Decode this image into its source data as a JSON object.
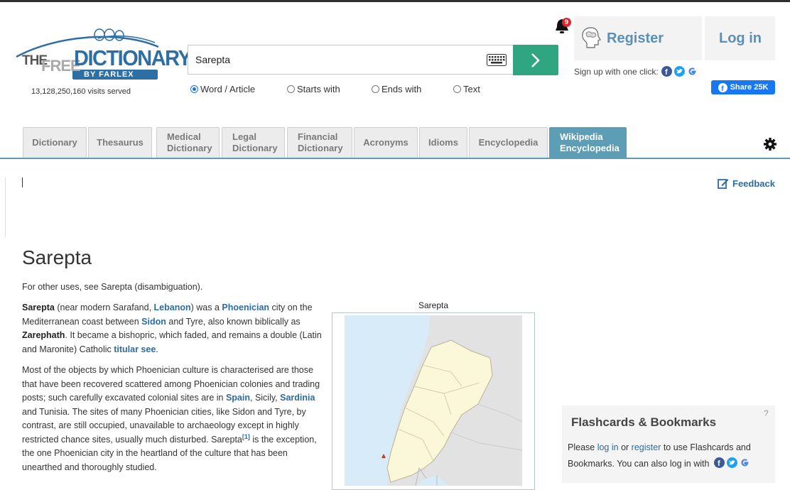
{
  "logo": {
    "the": "THE",
    "free": "FREE",
    "dictionary": "DICTIONARY",
    "byline": "BY FARLEX"
  },
  "visits": "13,128,250,160 visits served",
  "search": {
    "value": "Sarepta",
    "keyboard_icon": "keyboard-icon",
    "go_icon": "chevron-right-icon"
  },
  "search_modes": [
    {
      "label": "Word / Article",
      "selected": true
    },
    {
      "label": "Starts with",
      "selected": false
    },
    {
      "label": "Ends with",
      "selected": false
    },
    {
      "label": "Text",
      "selected": false
    }
  ],
  "notifications": {
    "count": "9"
  },
  "account": {
    "register": "Register",
    "login": "Log in",
    "signup_text": "Sign up with one click:"
  },
  "share": {
    "label": "Share 25K"
  },
  "tabs": [
    {
      "label": "Dictionary"
    },
    {
      "label": "Thesaurus"
    },
    {
      "label": "Medical Dictionary"
    },
    {
      "label": "Legal Dictionary"
    },
    {
      "label": "Financial Dictionary"
    },
    {
      "label": "Acronyms"
    },
    {
      "label": "Idioms"
    },
    {
      "label": "Encyclopedia"
    },
    {
      "label": "Wikipedia Encyclopedia",
      "active": true
    }
  ],
  "feedback": "Feedback",
  "article": {
    "title": "Sarepta",
    "disambig": "For other uses, see Sarepta (disambiguation).",
    "p1": {
      "t1": "Sarepta",
      "t2": " (near modern Sarafand, ",
      "l1": "Lebanon",
      "t3": ") was a ",
      "l2": "Phoenician",
      "t4": " city on the Mediterranean coast between ",
      "l3": "Sidon",
      "t5": " and Tyre, also known biblically as ",
      "t6": "Zarephath",
      "t7": ". It became a bishopric, which faded, and remains a double (Latin and Maronite) Catholic ",
      "l4": "titular see",
      "t8": "."
    },
    "p2": {
      "t1": "Most of the objects by which Phoenician culture is characterised are those that have been recovered scattered among Phoenician colonies and trading posts; such carefully excavated colonial sites are in ",
      "l1": "Spain",
      "t2": ", Sicily, ",
      "l2": "Sardinia",
      "t3": " and Tunisia. The sites of many Phoenician cities, like Sidon and Tyre, by contrast, are still occupied, unavailable to archaeology except in highly restricted chance sites, usually much disturbed. Sarepta",
      "ref": "[1]",
      "t4": " is the exception, the one Phoenician city in the heartland of the culture that has been unearthed and thoroughly studied."
    }
  },
  "infobox": {
    "title": "Sarepta"
  },
  "flashcards": {
    "title": "Flashcards & Bookmarks",
    "help": "?",
    "t1": "Please ",
    "login": "log in",
    "t2": " or ",
    "register": "register",
    "t3": " to use Flashcards and Bookmarks. You can also log in with"
  },
  "colors": {
    "accent": "#5b9eb6",
    "go_button": "#2fa67f",
    "link": "#2b6ca3",
    "facebook": "#1877f2"
  }
}
